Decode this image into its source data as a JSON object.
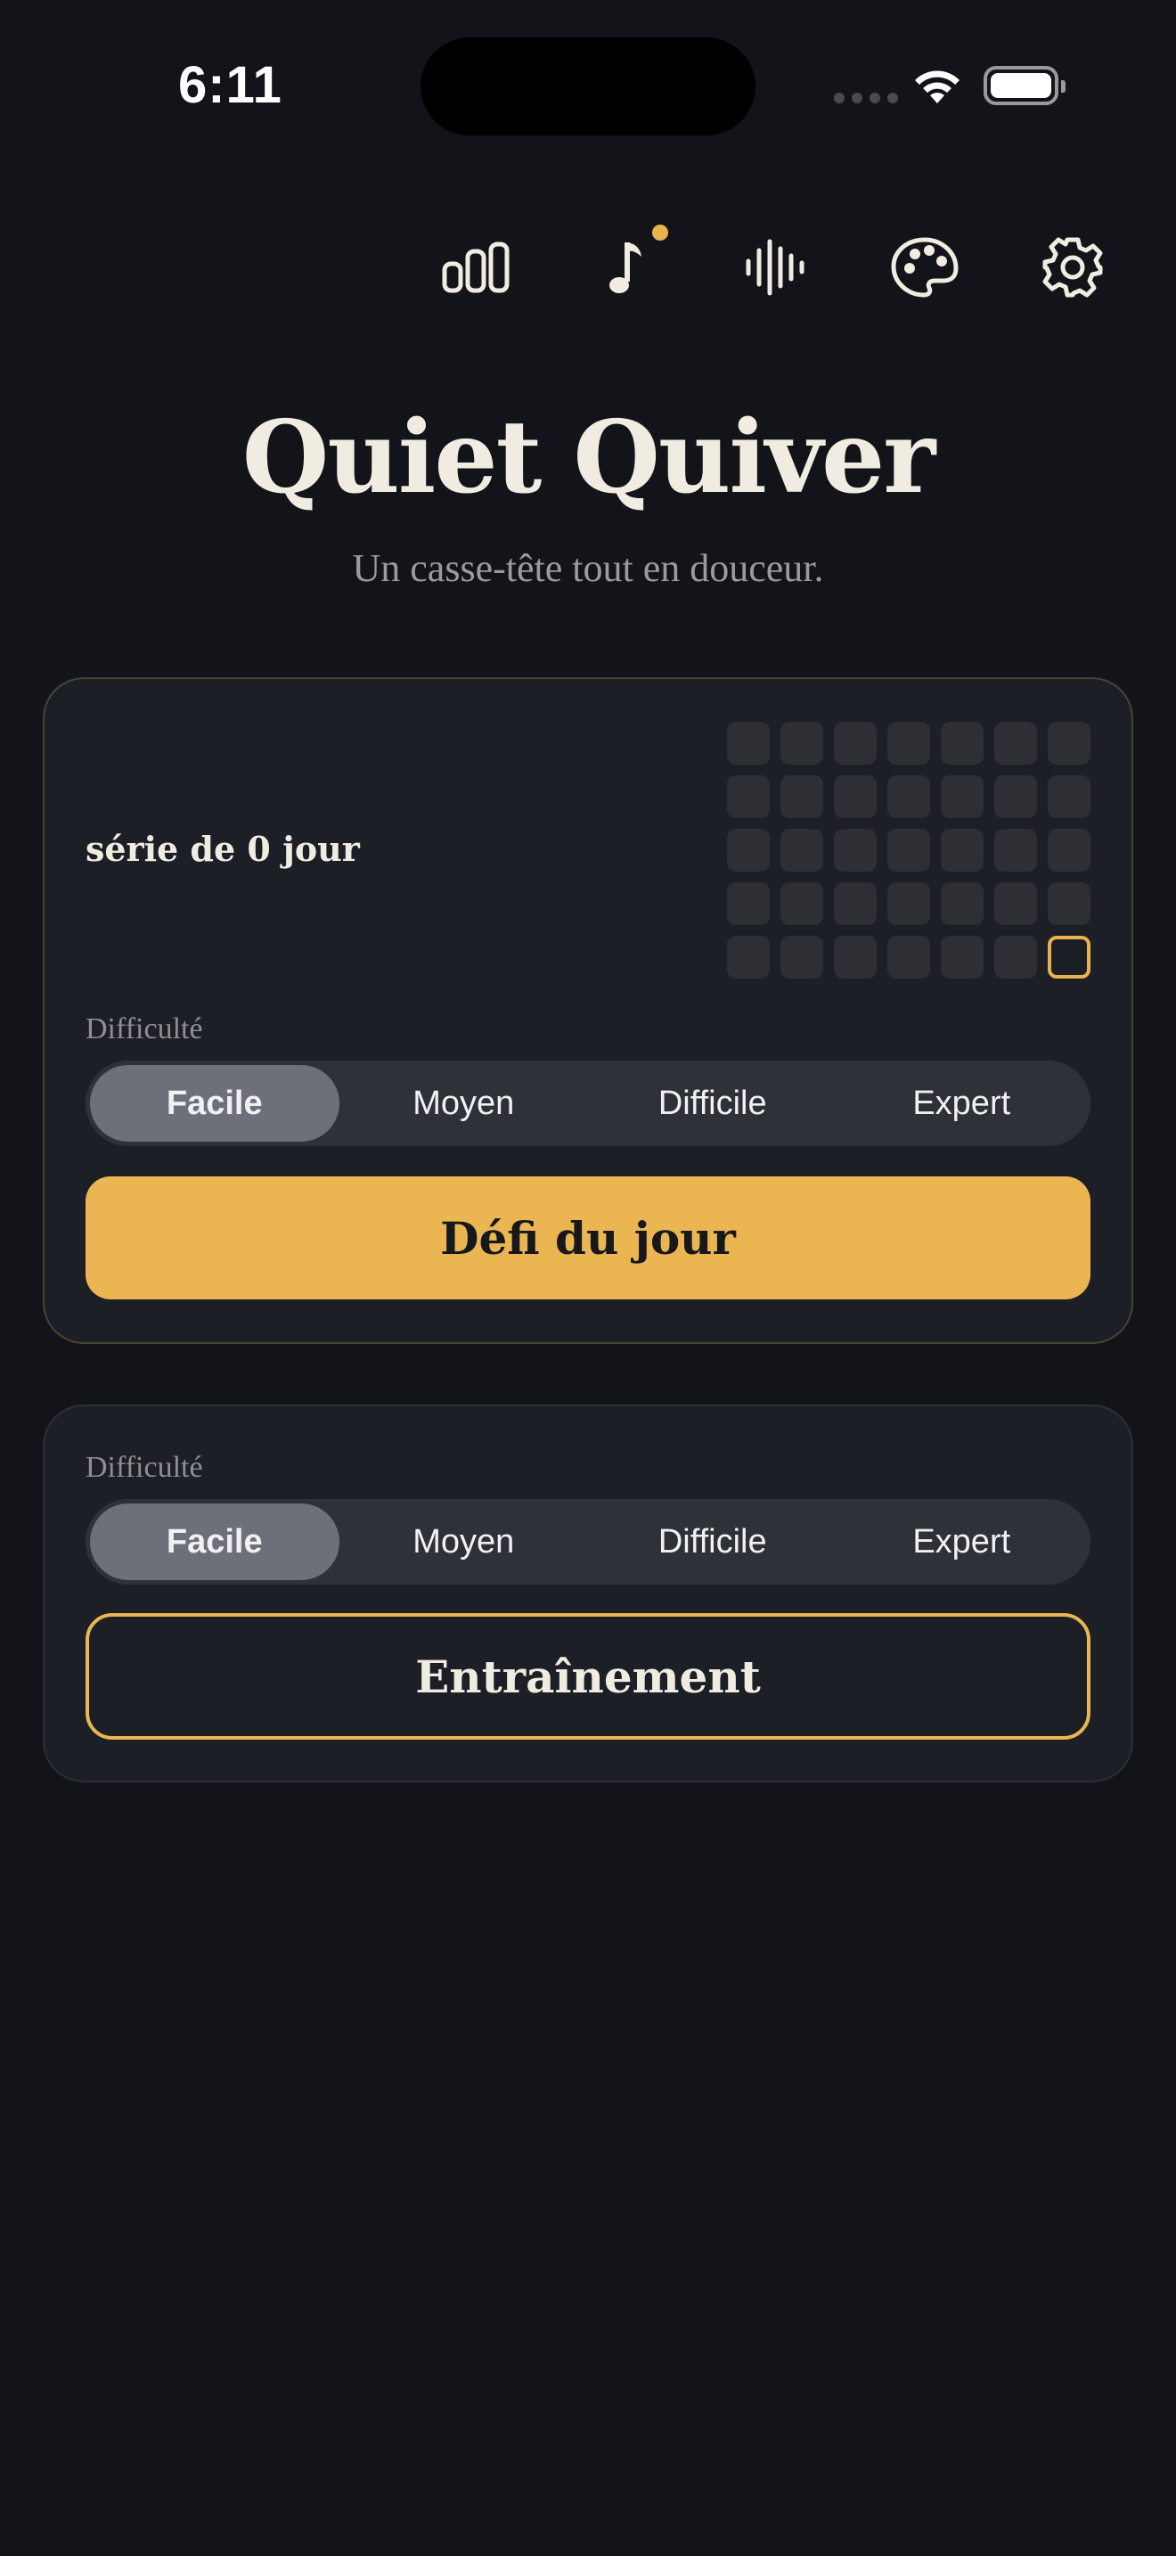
{
  "status_bar": {
    "time": "6:11"
  },
  "toolbar": {
    "icons": [
      "stats-icon",
      "music-icon",
      "sound-wave-icon",
      "palette-icon",
      "gear-icon"
    ],
    "music_has_notification": true
  },
  "header": {
    "title": "Quiet Quiver",
    "subtitle": "Un casse-tête tout en douceur."
  },
  "daily_card": {
    "streak_text": "série de 0 jour",
    "calendar": {
      "rows": 5,
      "columns": 7,
      "today_index": 34
    },
    "difficulty_label": "Difficulté",
    "difficulty_options": [
      "Facile",
      "Moyen",
      "Difficile",
      "Expert"
    ],
    "selected_difficulty": "Facile",
    "button_label": "Défi du jour"
  },
  "practice_card": {
    "difficulty_label": "Difficulté",
    "difficulty_options": [
      "Facile",
      "Moyen",
      "Difficile",
      "Expert"
    ],
    "selected_difficulty": "Facile",
    "button_label": "Entraînement"
  },
  "colors": {
    "background": "#131419",
    "card": "#1d1f26",
    "accent": "#ebb652",
    "text": "#f1ece1",
    "muted": "#9b9aa0"
  }
}
